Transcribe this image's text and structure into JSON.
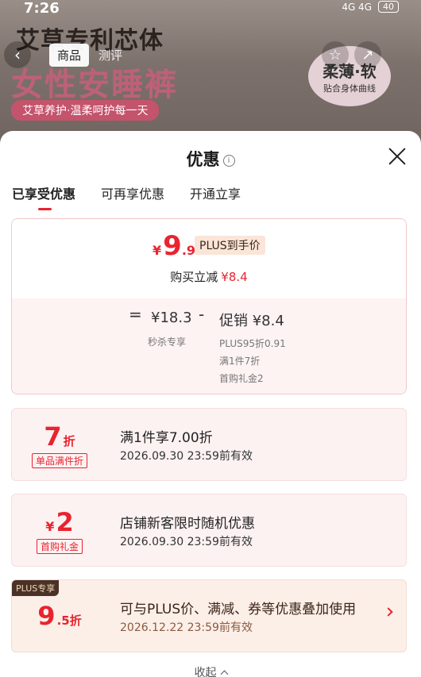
{
  "status_bar": {
    "time": "7:26",
    "network": "4G 4G",
    "battery": "40"
  },
  "product_bg": {
    "brand": "艾草专利芯体",
    "headline": "女性安睡裤",
    "tagline": "艾草养护·温柔呵护每一天",
    "badge_title": "柔薄·软",
    "badge_sub": "贴合身体曲线",
    "tabs": [
      "商品",
      "测评"
    ]
  },
  "sheet": {
    "title": "优惠",
    "info_icon": "i",
    "tabs": [
      "已享受优惠",
      "可再享优惠",
      "开通立享"
    ]
  },
  "price": {
    "currency": "¥",
    "integer": "9",
    "decimal": ".9",
    "plus_tag": "PLUS到手价",
    "buy_label": "购买立减",
    "buy_amount": "¥8.4",
    "equals": "=",
    "original": "¥18.3",
    "original_label": "秒杀专享",
    "minus": "-",
    "promo": "促销 ¥8.4",
    "promo_lines": [
      "PLUS95折0.91",
      "满1件7折",
      "首购礼金2"
    ]
  },
  "coupons": [
    {
      "big": "7",
      "suffix": "折",
      "prefix": "",
      "tag": "单品满件折",
      "title": "满1件享7.00折",
      "date": "2026.09.30 23:59前有效"
    },
    {
      "big": "2",
      "suffix": "",
      "prefix": "¥",
      "tag": "首购礼金",
      "title": "店铺新客限时随机优惠",
      "date": "2026.09.30 23:59前有效"
    },
    {
      "big": "9",
      "suffix": ".5折",
      "prefix": "",
      "badge": "PLUS专享",
      "title": "可与PLUS价、满减、券等优惠叠加使用",
      "date": "2026.12.22 23:59前有效"
    }
  ],
  "collapse_label": "收起",
  "colors": {
    "accent": "#e8242f",
    "plus_dark": "#4a3226"
  }
}
